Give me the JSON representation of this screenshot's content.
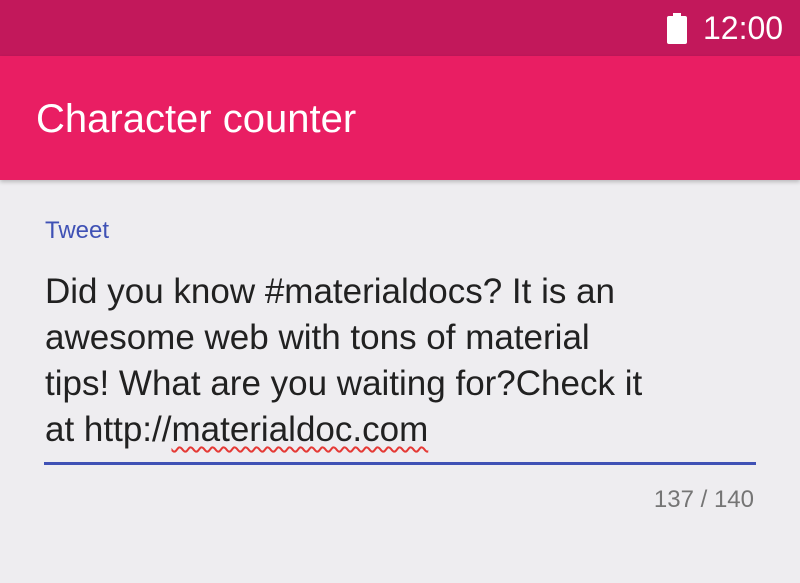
{
  "status_bar": {
    "time": "12:00",
    "icons": [
      "battery-icon"
    ],
    "color": "#c2185b"
  },
  "app_bar": {
    "title": "Character counter",
    "color": "#e91e63"
  },
  "tweet_field": {
    "label": "Tweet",
    "lines": [
      "Did you know #materialdocs? It is an",
      "awesome web with tons of material",
      "tips! What are you waiting for?Check it"
    ],
    "last_line_prefix": "at http://",
    "last_line_misspelled": "materialdoc.com",
    "counter": "137 / 140",
    "accent_color": "#3f51b5"
  }
}
